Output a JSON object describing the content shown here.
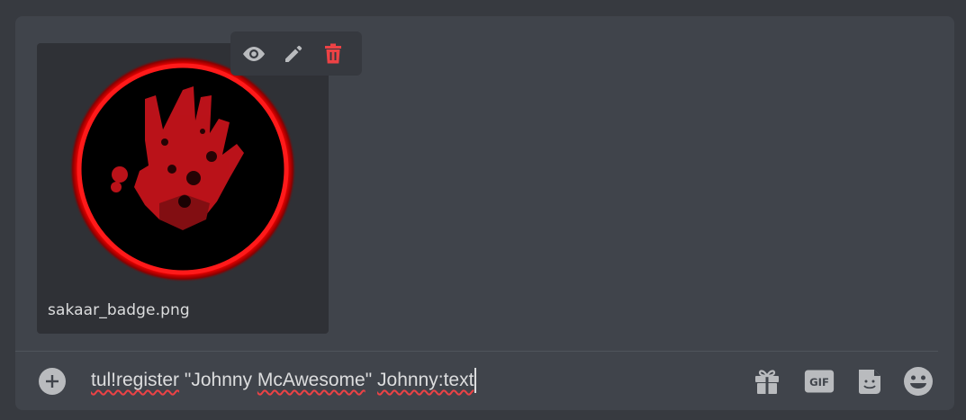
{
  "attachment": {
    "filename": "sakaar_badge.png",
    "image_description": "red hand print inside red glowing circle",
    "actions": {
      "view_icon": "eye-icon",
      "edit_icon": "pencil-icon",
      "delete_icon": "trash-icon"
    }
  },
  "composer": {
    "add_icon": "plus-circle-icon",
    "message_parts": [
      {
        "text": "tul!register",
        "misspelled": true
      },
      {
        "text": " \"Johnny ",
        "misspelled": false
      },
      {
        "text": "McAwesome",
        "misspelled": true
      },
      {
        "text": "\" ",
        "misspelled": false
      },
      {
        "text": "Johnny:text",
        "misspelled": true
      }
    ],
    "gif_label": "GIF",
    "icons": {
      "gift": "gift-icon",
      "gif": "gif-icon",
      "sticker": "sticker-icon",
      "emoji": "emoji-icon"
    }
  },
  "colors": {
    "background": "#373a40",
    "composer_bg": "#40444b",
    "card_bg": "#2f3136",
    "text": "#dcddde",
    "icon": "#b9bbbe",
    "danger": "#ed4245",
    "spellcheck_underline": "#ed4245"
  }
}
